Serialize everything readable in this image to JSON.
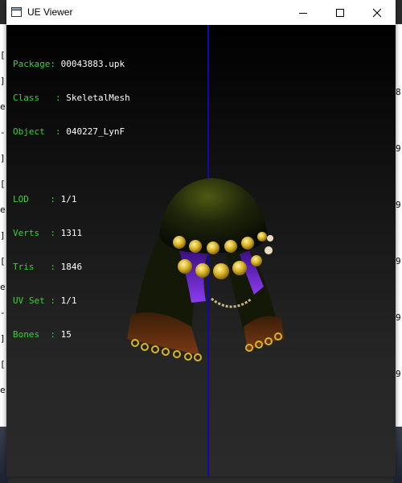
{
  "window": {
    "title": "UE Viewer",
    "minimize_glyph": "—",
    "maximize_glyph": "☐",
    "close_glyph": "✕"
  },
  "info": {
    "package_label": "Package",
    "package_value": "00043883.upk",
    "class_label": "Class",
    "class_value": "SkeletalMesh",
    "object_label": "Object",
    "object_value": "040227_LynF",
    "lod_label": "LOD",
    "lod_value": "1/1",
    "verts_label": "Verts",
    "verts_value": "1311",
    "tris_label": "Tris",
    "tris_value": "1846",
    "uvset_label": "UV Set",
    "uvset_value": "1/1",
    "bones_label": "Bones",
    "bones_value": "15"
  },
  "background_app": {
    "left_glyphs": [
      "[",
      "]",
      "e",
      "-",
      "]",
      "[",
      "e",
      "]",
      "[",
      "e",
      "-",
      "]",
      "[",
      "e"
    ],
    "right_glyphs": [
      "8",
      "9",
      "9",
      "9",
      "9",
      "9"
    ]
  },
  "colors": {
    "label": "#38d338",
    "value": "#ffffff",
    "axis": "#0c0ca8",
    "hat_dark": "#1d2308",
    "gold": "#d9b52a",
    "purple": "#6a1fd0",
    "fringe": "#5a2f10"
  },
  "icons": [
    "app-window-icon",
    "minimize-icon",
    "maximize-icon",
    "close-icon"
  ]
}
